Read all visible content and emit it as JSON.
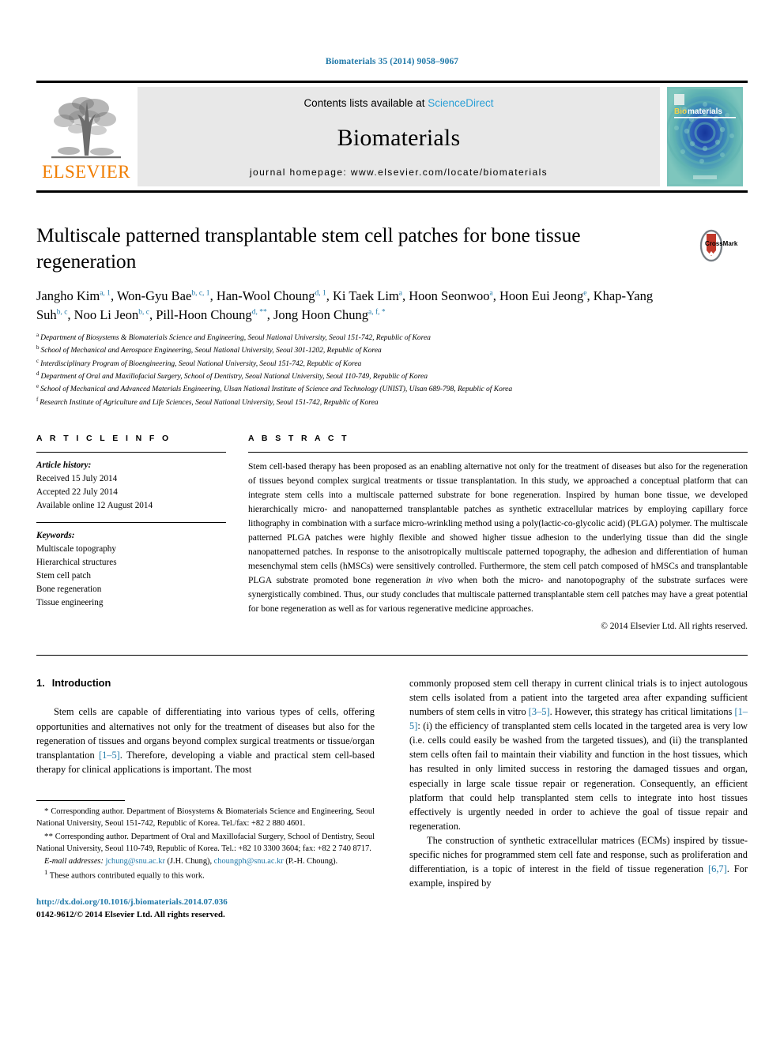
{
  "running_head": "Biomaterials 35 (2014) 9058–9067",
  "masthead": {
    "publisher_name": "ELSEVIER",
    "contents_prefix": "Contents lists available at ",
    "contents_link": "ScienceDirect",
    "journal_title": "Biomaterials",
    "homepage": "journal homepage: www.elsevier.com/locate/biomaterials",
    "cover_title_a": "Bio",
    "cover_title_b": "materials"
  },
  "article": {
    "title": "Multiscale patterned transplantable stem cell patches for bone tissue regeneration",
    "crossmark_label": "CrossMark"
  },
  "authors": [
    {
      "name": "Jangho Kim",
      "sup": "a, 1",
      "sep": ", "
    },
    {
      "name": "Won-Gyu Bae",
      "sup": "b, c, 1",
      "sep": ", "
    },
    {
      "name": "Han-Wool Choung",
      "sup": "d, 1",
      "sep": ", "
    },
    {
      "name": "Ki Taek Lim",
      "sup": "a",
      "sep": ", "
    },
    {
      "name": "Hoon Seonwoo",
      "sup": "a",
      "sep": ", "
    },
    {
      "name": "Hoon Eui Jeong",
      "sup": "e",
      "sep": ", "
    },
    {
      "name": "Khap-Yang Suh",
      "sup": "b, c",
      "sep": ", "
    },
    {
      "name": "Noo Li Jeon",
      "sup": "b, c",
      "sep": ", "
    },
    {
      "name": "Pill-Hoon Choung",
      "sup": "d, **",
      "sep": ", "
    },
    {
      "name": "Jong Hoon Chung",
      "sup": "a, f, *",
      "sep": ""
    }
  ],
  "affiliations": [
    {
      "key": "a",
      "text": "Department of Biosystems & Biomaterials Science and Engineering, Seoul National University, Seoul 151-742, Republic of Korea"
    },
    {
      "key": "b",
      "text": "School of Mechanical and Aerospace Engineering, Seoul National University, Seoul 301-1202, Republic of Korea"
    },
    {
      "key": "c",
      "text": "Interdisciplinary Program of Bioengineering, Seoul National University, Seoul 151-742, Republic of Korea"
    },
    {
      "key": "d",
      "text": "Department of Oral and Maxillofacial Surgery, School of Dentistry, Seoul National University, Seoul 110-749, Republic of Korea"
    },
    {
      "key": "e",
      "text": "School of Mechanical and Advanced Materials Engineering, Ulsan National Institute of Science and Technology (UNIST), Ulsan 689-798, Republic of Korea"
    },
    {
      "key": "f",
      "text": "Research Institute of Agriculture and Life Sciences, Seoul National University, Seoul 151-742, Republic of Korea"
    }
  ],
  "article_info": {
    "heading": "A R T I C L E  I N F O",
    "history_label": "Article history:",
    "history": [
      "Received 15 July 2014",
      "Accepted 22 July 2014",
      "Available online 12 August 2014"
    ],
    "keywords_label": "Keywords:",
    "keywords": [
      "Multiscale topography",
      "Hierarchical structures",
      "Stem cell patch",
      "Bone regeneration",
      "Tissue engineering"
    ]
  },
  "abstract": {
    "heading": "A B S T R A C T",
    "part1": "Stem cell-based therapy has been proposed as an enabling alternative not only for the treatment of diseases but also for the regeneration of tissues beyond complex surgical treatments or tissue transplantation. In this study, we approached a conceptual platform that can integrate stem cells into a multiscale patterned substrate for bone regeneration. Inspired by human bone tissue, we developed hierarchically micro- and nanopatterned transplantable patches as synthetic extracellular matrices by employing capillary force lithography in combination with a surface micro-wrinkling method using a poly(lactic-co-glycolic acid) (PLGA) polymer. The multiscale patterned PLGA patches were highly flexible and showed higher tissue adhesion to the underlying tissue than did the single nanopatterned patches. In response to the anisotropically multiscale patterned topography, the adhesion and differentiation of human mesenchymal stem cells (hMSCs) were sensitively controlled. Furthermore, the stem cell patch composed of hMSCs and transplantable PLGA substrate promoted bone regeneration ",
    "italic": "in vivo",
    "part2": " when both the micro- and nanotopography of the substrate surfaces were synergistically combined. Thus, our study concludes that multiscale patterned transplantable stem cell patches may have a great potential for bone regeneration as well as for various regenerative medicine approaches.",
    "copyright": "© 2014 Elsevier Ltd. All rights reserved."
  },
  "introduction": {
    "number": "1.",
    "heading": "Introduction",
    "left_p1_a": "Stem cells are capable of differentiating into various types of cells, offering opportunities and alternatives not only for the treatment of diseases but also for the regeneration of tissues and organs beyond complex surgical treatments or tissue/organ transplantation ",
    "left_p1_ref": "[1–5]",
    "left_p1_b": ". Therefore, developing a viable and practical stem cell-based therapy for clinical applications is important. The most",
    "right_p1_a": "commonly proposed stem cell therapy in current clinical trials is to inject autologous stem cells isolated from a patient into the targeted area after expanding sufficient numbers of stem cells ",
    "right_p1_italic": "in vitro",
    "right_p1_b": " ",
    "right_p1_ref1": "[3–5]",
    "right_p1_c": ". However, this strategy has critical limitations ",
    "right_p1_ref2": "[1–5]",
    "right_p1_d": ": (i) the efficiency of transplanted stem cells located in the targeted area is very low (i.e. cells could easily be washed from the targeted tissues), and (ii) the transplanted stem cells often fail to maintain their viability and function in the host tissues, which has resulted in only limited success in restoring the damaged tissues and organ, especially in large scale tissue repair or regeneration. Consequently, an efficient platform that could help transplanted stem cells to integrate into host tissues effectively is urgently needed in order to achieve the goal of tissue repair and regeneration.",
    "right_p2_a": "The construction of synthetic extracellular matrices (ECMs) inspired by tissue-specific niches for programmed stem cell fate and response, such as proliferation and differentiation, is a topic of interest in the field of tissue regeneration ",
    "right_p2_ref": "[6,7]",
    "right_p2_b": ". For example, inspired by"
  },
  "footnotes": {
    "corr1_mark": "*",
    "corr1": " Corresponding author. Department of Biosystems & Biomaterials Science and Engineering, Seoul National University, Seoul 151-742, Republic of Korea. Tel./fax: +82 2 880 4601.",
    "corr2_mark": "**",
    "corr2": " Corresponding author. Department of Oral and Maxillofacial Surgery, School of Dentistry, Seoul National University, Seoul 110-749, Republic of Korea. Tel.: +82 10 3300 3604; fax: +82 2 740 8717.",
    "email_label": "E-mail addresses:",
    "email1": "jchung@snu.ac.kr",
    "email1_owner": " (J.H. Chung), ",
    "email2": "choungph@snu.ac.kr",
    "email2_owner": " (P.-H. Choung).",
    "eq_mark": "1",
    "eq_text": " These authors contributed equally to this work."
  },
  "doi_block": {
    "doi": "http://dx.doi.org/10.1016/j.biomaterials.2014.07.036",
    "issn_line": "0142-9612/© 2014 Elsevier Ltd. All rights reserved."
  },
  "colors": {
    "link_blue": "#1f78a8",
    "sciencedirect_blue": "#2a9fd6",
    "elsevier_orange": "#f07d00"
  }
}
